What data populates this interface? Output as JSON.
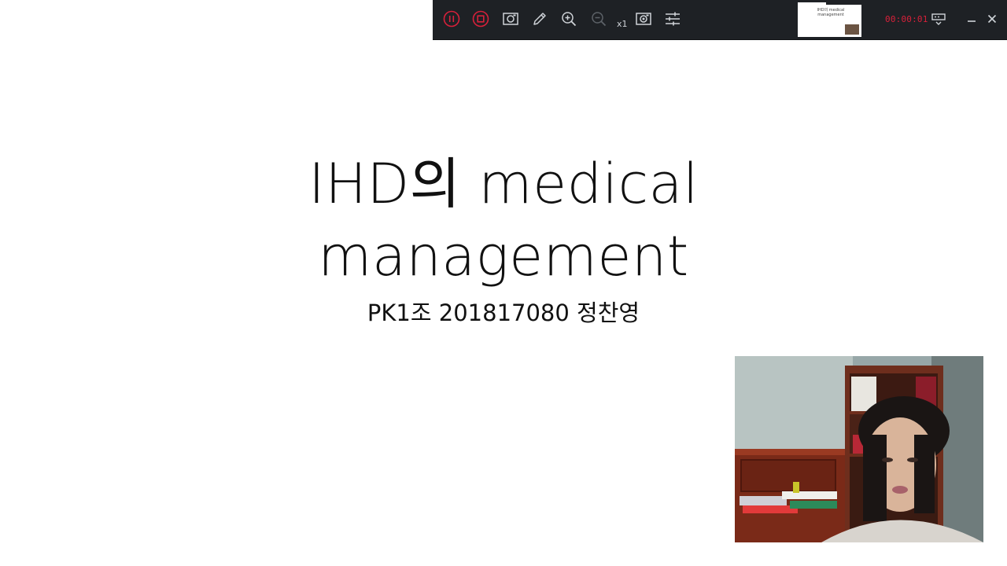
{
  "slide": {
    "title_line1": "IHD의 medical",
    "title_line2": "management",
    "subtitle": "PK1조 201817080 정찬영"
  },
  "toolbar": {
    "zoom_level": "x1",
    "timer": "00:00:01",
    "preview": {
      "title_text": "IHD의 medical management"
    },
    "icons": {
      "pause": "pause-icon",
      "stop": "stop-icon",
      "screenshot": "camera-icon",
      "pen": "pencil-icon",
      "zoom_in": "zoom-in-icon",
      "zoom_out": "zoom-out-icon",
      "webcam": "webcam-icon",
      "settings": "sliders-icon",
      "display": "display-icon",
      "minimize": "minimize-icon",
      "close": "close-icon"
    },
    "colors": {
      "background": "#1e2125",
      "record_red": "#d8203a",
      "icon": "#cfd3d8"
    }
  }
}
